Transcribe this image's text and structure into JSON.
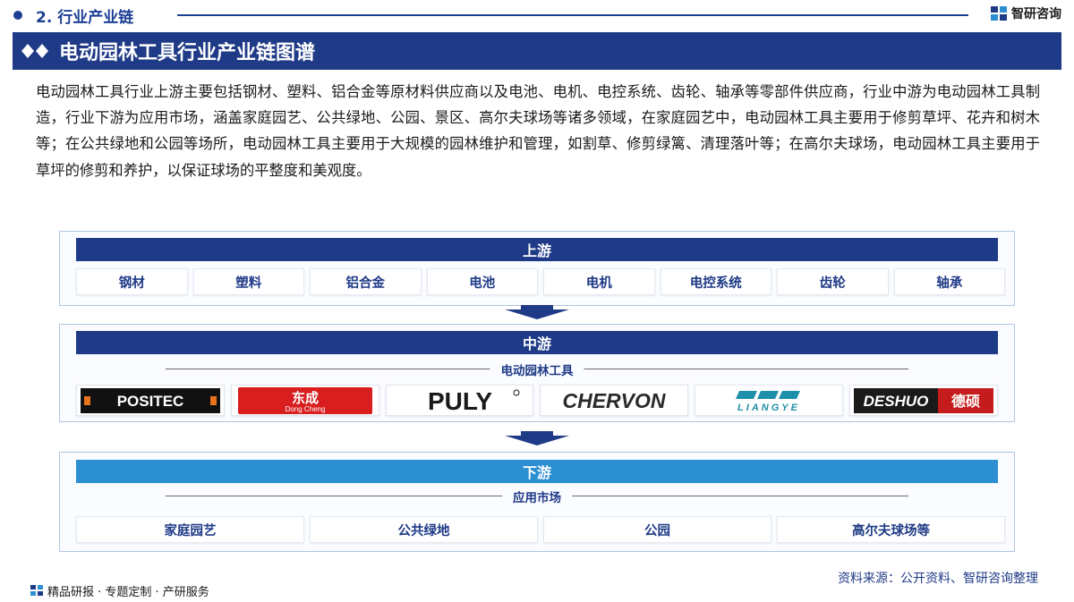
{
  "header": {
    "section": "2. 行业产业链",
    "brand": "智研咨询"
  },
  "title": "电动园林工具行业产业链图谱",
  "intro": "电动园林工具行业上游主要包括钢材、塑料、铝合金等原材料供应商以及电池、电机、电控系统、齿轮、轴承等零部件供应商，行业中游为电动园林工具制造，行业下游为应用市场，涵盖家庭园艺、公共绿地、公园、景区、高尔夫球场等诸多领域，在家庭园艺中，电动园林工具主要用于修剪草坪、花卉和树木等；在公共绿地和公园等场所，电动园林工具主要用于大规模的园林维护和管理，如割草、修剪绿篱、清理落叶等；在高尔夫球场，电动园林工具主要用于草坪的修剪和养护，以保证球场的平整度和美观度。",
  "upstream": {
    "label": "上游",
    "items": [
      "钢材",
      "塑料",
      "铝合金",
      "电池",
      "电机",
      "电控系统",
      "齿轮",
      "轴承"
    ]
  },
  "midstream": {
    "label": "中游",
    "sublabel": "电动园林工具",
    "logos": [
      {
        "name": "POSITEC",
        "icon": "positec-logo"
      },
      {
        "name": "东成",
        "sub": "Dong Cheng",
        "icon": "dongcheng-logo"
      },
      {
        "name": "PULY",
        "icon": "puly-logo"
      },
      {
        "name": "CHERVON",
        "icon": "chervon-logo"
      },
      {
        "name": "LIANGYE",
        "icon": "liangye-logo"
      },
      {
        "name": "DESHUO",
        "cn": "德硕",
        "icon": "deshuo-logo"
      }
    ]
  },
  "downstream": {
    "label": "下游",
    "sublabel": "应用市场",
    "items": [
      "家庭园艺",
      "公共绿地",
      "公园",
      "高尔夫球场等"
    ]
  },
  "source": "资料来源：公开资料、智研咨询整理",
  "footer": "精品研报 · 专题定制 · 产研服务",
  "colors": {
    "navy": "#1f3a87",
    "lightblue": "#2b8fd1"
  }
}
